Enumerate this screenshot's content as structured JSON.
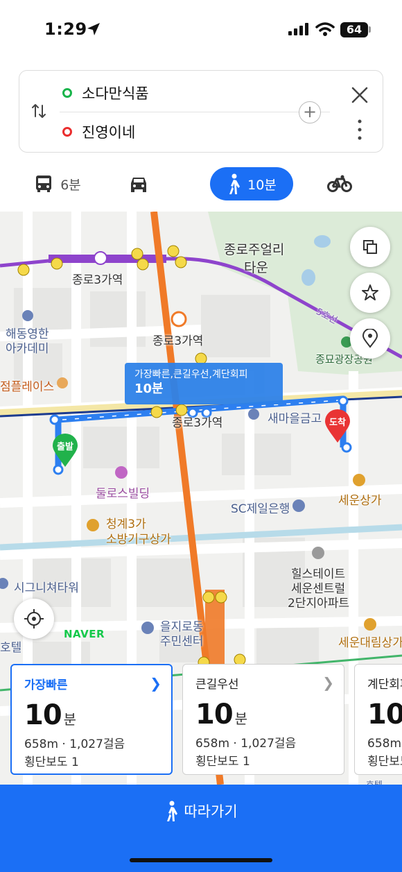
{
  "status_bar": {
    "time": "1:29",
    "battery": "64"
  },
  "search": {
    "origin": "소다만식품",
    "destination": "진영이네"
  },
  "tabs": [
    {
      "mode": "bus",
      "label": "6분"
    },
    {
      "mode": "car",
      "label": ""
    },
    {
      "mode": "walk",
      "label": "10분",
      "active": true
    },
    {
      "mode": "bike",
      "label": ""
    }
  ],
  "map": {
    "labels": {
      "jongno_jewelry_1": "종로주얼리",
      "jongno_jewelry_2": "타운",
      "jongno3ga_station_left": "종로3가역",
      "jongno3ga_station_mid": "종로3가역",
      "jongno3ga_station_bottom": "종로3가역",
      "haedong_1": "해동영한",
      "haedong_2": "아카데미",
      "jongmyo": "종묘광장공원",
      "line5": "5호선",
      "saemaeul": "새마을금고",
      "jeomplace": "점플레이스",
      "dulo": "둘로스빌딩",
      "sc_bank": "SC제일은행",
      "sewoon_mall": "세운상가",
      "cheonggye_1": "청계3가",
      "cheonggye_2": "소방기구상가",
      "signature": "시그니쳐타워",
      "hillstate_1": "힐스테이트",
      "hillstate_2": "세운센트럴",
      "hillstate_3": "2단지아파트",
      "euljiro_1": "을지로동",
      "euljiro_2": "주민센터",
      "sewoon_daerim": "세운대림상가",
      "hotel_left": "호텔",
      "hotel_bottom": "호텔"
    },
    "route_tip": {
      "options": "가장빠른,큰길우선,계단회피",
      "time": "10분"
    },
    "start_pin": "출발",
    "end_pin": "도착",
    "watermark": "NAVER",
    "line_colors": {
      "line1": "#1c3b8f",
      "line3": "#f07a28",
      "line5": "#8e44cc",
      "walk": "#2d7ff0"
    },
    "exit_numbers": [
      "4",
      "5",
      "6",
      "3",
      "7",
      "8",
      "3",
      "9",
      "10",
      "11",
      "12",
      "14",
      "15",
      "1",
      "2",
      "4",
      "5",
      "6",
      "3"
    ]
  },
  "routes": [
    {
      "name": "가장빠른",
      "minutes": "10",
      "unit": "분",
      "distance_steps": "658m · 1,027걸음",
      "crossings": "횡단보도 1",
      "selected": true
    },
    {
      "name": "큰길우선",
      "minutes": "10",
      "unit": "분",
      "distance_steps": "658m · 1,027걸음",
      "crossings": "횡단보도 1",
      "selected": false
    },
    {
      "name": "계단회피",
      "minutes": "10",
      "unit": "분",
      "distance_steps": "658m · 1,027걸음",
      "crossings": "횡단보도 1",
      "selected": false
    }
  ],
  "follow_button": {
    "label": "따라가기"
  }
}
